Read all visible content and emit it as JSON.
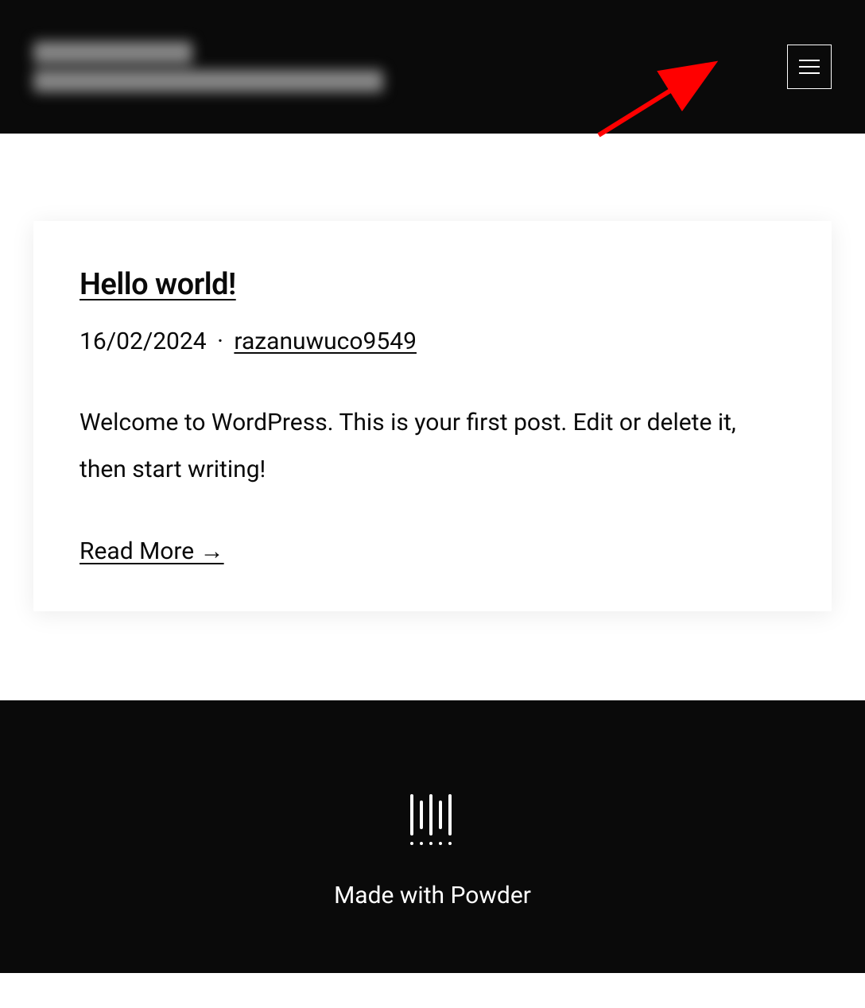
{
  "header": {
    "site_title_line1": "SITE TITLE",
    "site_title_line2": "Just another WordPress site"
  },
  "post": {
    "title": "Hello world!",
    "date": "16/02/2024",
    "separator": "·",
    "author": "razanuwuco9549",
    "excerpt": "Welcome to WordPress. This is your first post. Edit or delete it, then start writing!",
    "read_more": "Read More →"
  },
  "footer": {
    "text": "Made with Powder"
  }
}
